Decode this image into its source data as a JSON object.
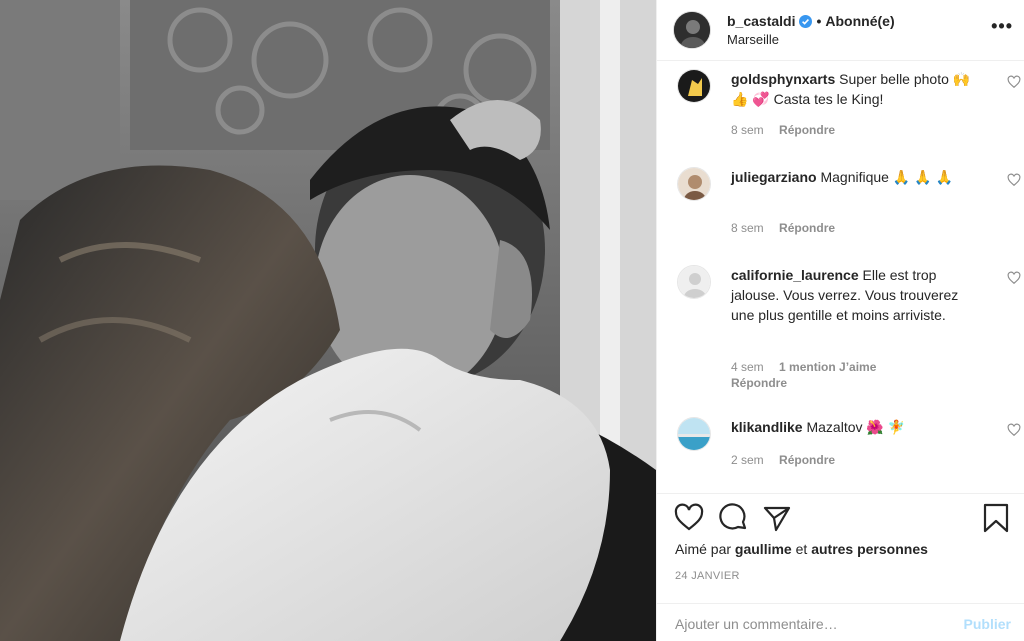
{
  "post": {
    "username": "b_castaldi",
    "follow_status": "Abonné(e)",
    "separator": "•",
    "location": "Marseille",
    "more_label": "•••",
    "verified_color": "#3897f0"
  },
  "comments": [
    {
      "username": "goldsphynxarts",
      "text": "Super belle photo 🙌 👍 💞 Casta tes le King!",
      "time": "8 sem",
      "reply": "Répondre"
    },
    {
      "username": "juliegarziano",
      "text": "Magnifique 🙏 🙏 🙏",
      "time": "8 sem",
      "reply": "Répondre"
    },
    {
      "username": "californie_laurence",
      "text": "Elle est trop jalouse. Vous verrez. Vous trouverez une plus gentille et moins arriviste.",
      "time": "4 sem",
      "likes": "1 mention J’aime",
      "reply": "Répondre"
    },
    {
      "username": "klikandlike",
      "text": "Mazaltov 🌺 🧚",
      "time": "2 sem",
      "reply": "Répondre"
    }
  ],
  "actions": {
    "liked_by_prefix": "Aimé par",
    "liked_by_user": "gaullime",
    "liked_by_and": "et",
    "liked_by_others": "autres personnes",
    "date": "24 JANVIER"
  },
  "add_comment": {
    "placeholder": "Ajouter un commentaire…",
    "publish_label": "Publier",
    "publish_color": "#b2dffc"
  }
}
